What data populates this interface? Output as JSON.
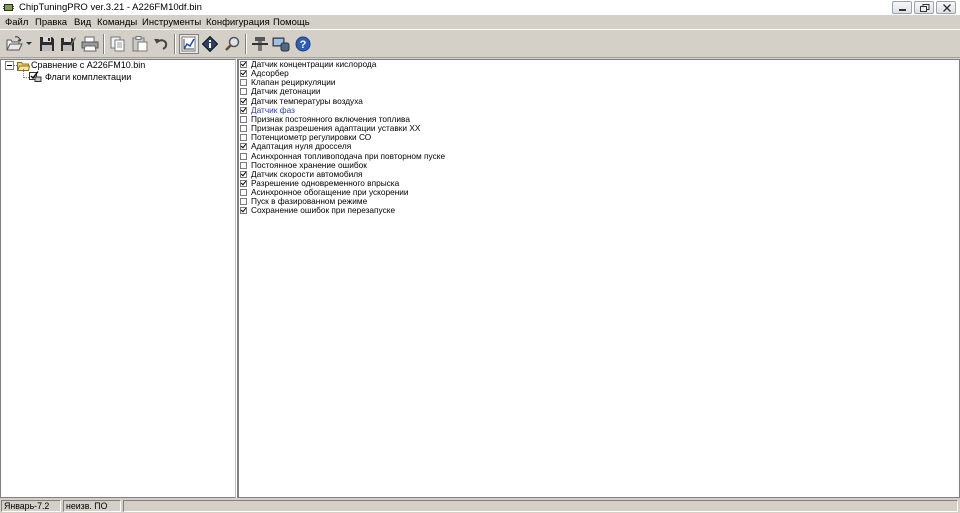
{
  "window": {
    "title": "ChipTuningPRO ver.3.21 - A226FM10df.bin"
  },
  "menu": [
    {
      "label": "Файл"
    },
    {
      "label": "Правка"
    },
    {
      "label": "Вид"
    },
    {
      "label": "Команды"
    },
    {
      "label": "Инструменты"
    },
    {
      "label": "Конфигурация"
    },
    {
      "label": "Помощь"
    }
  ],
  "toolbar": {
    "icons": [
      "open-icon",
      "save-icon",
      "save-as-icon",
      "print-icon",
      "copy-icon",
      "paste-icon",
      "undo-icon",
      "chart-icon",
      "info-icon",
      "search-icon",
      "tools-icon",
      "connect-icon",
      "help-icon"
    ]
  },
  "tree": {
    "root_label": "Сравнение с A226FM10.bin",
    "child_label": "Флаги комплектации"
  },
  "flags": [
    {
      "label": "Датчик концентрации кислорода",
      "checked": true
    },
    {
      "label": "Адсорбер",
      "checked": true
    },
    {
      "label": "Клапан рециркуляции",
      "checked": false
    },
    {
      "label": "Датчик детонации",
      "checked": false
    },
    {
      "label": "Датчик температуры воздуха",
      "checked": true
    },
    {
      "label": "Датчик фаз",
      "checked": true,
      "highlight": true
    },
    {
      "label": "Признак постоянного включения топлива",
      "checked": false
    },
    {
      "label": "Признак разрешения адаптации уставки ХХ",
      "checked": false
    },
    {
      "label": "Потенциометр регулировки СО",
      "checked": false
    },
    {
      "label": "Адаптация нуля дросселя",
      "checked": true
    },
    {
      "label": "Асинхронная топливоподача при повторном пуске",
      "checked": false
    },
    {
      "label": "Постоянное хранение ошибок",
      "checked": false
    },
    {
      "label": "Датчик скорости автомобиля",
      "checked": true
    },
    {
      "label": "Разрешение одновременного впрыска",
      "checked": true
    },
    {
      "label": "Асинхронное обогащение при ускорении",
      "checked": false
    },
    {
      "label": "Пуск в фазированном режиме",
      "checked": false
    },
    {
      "label": "Сохранение ошибок при перезапуске",
      "checked": true
    }
  ],
  "status": {
    "ecu": "Январь-7.2",
    "software": "неизв. ПО"
  },
  "colors": {
    "highlight_text": "#2d3ebf",
    "window_bg": "#d4d0c8"
  }
}
